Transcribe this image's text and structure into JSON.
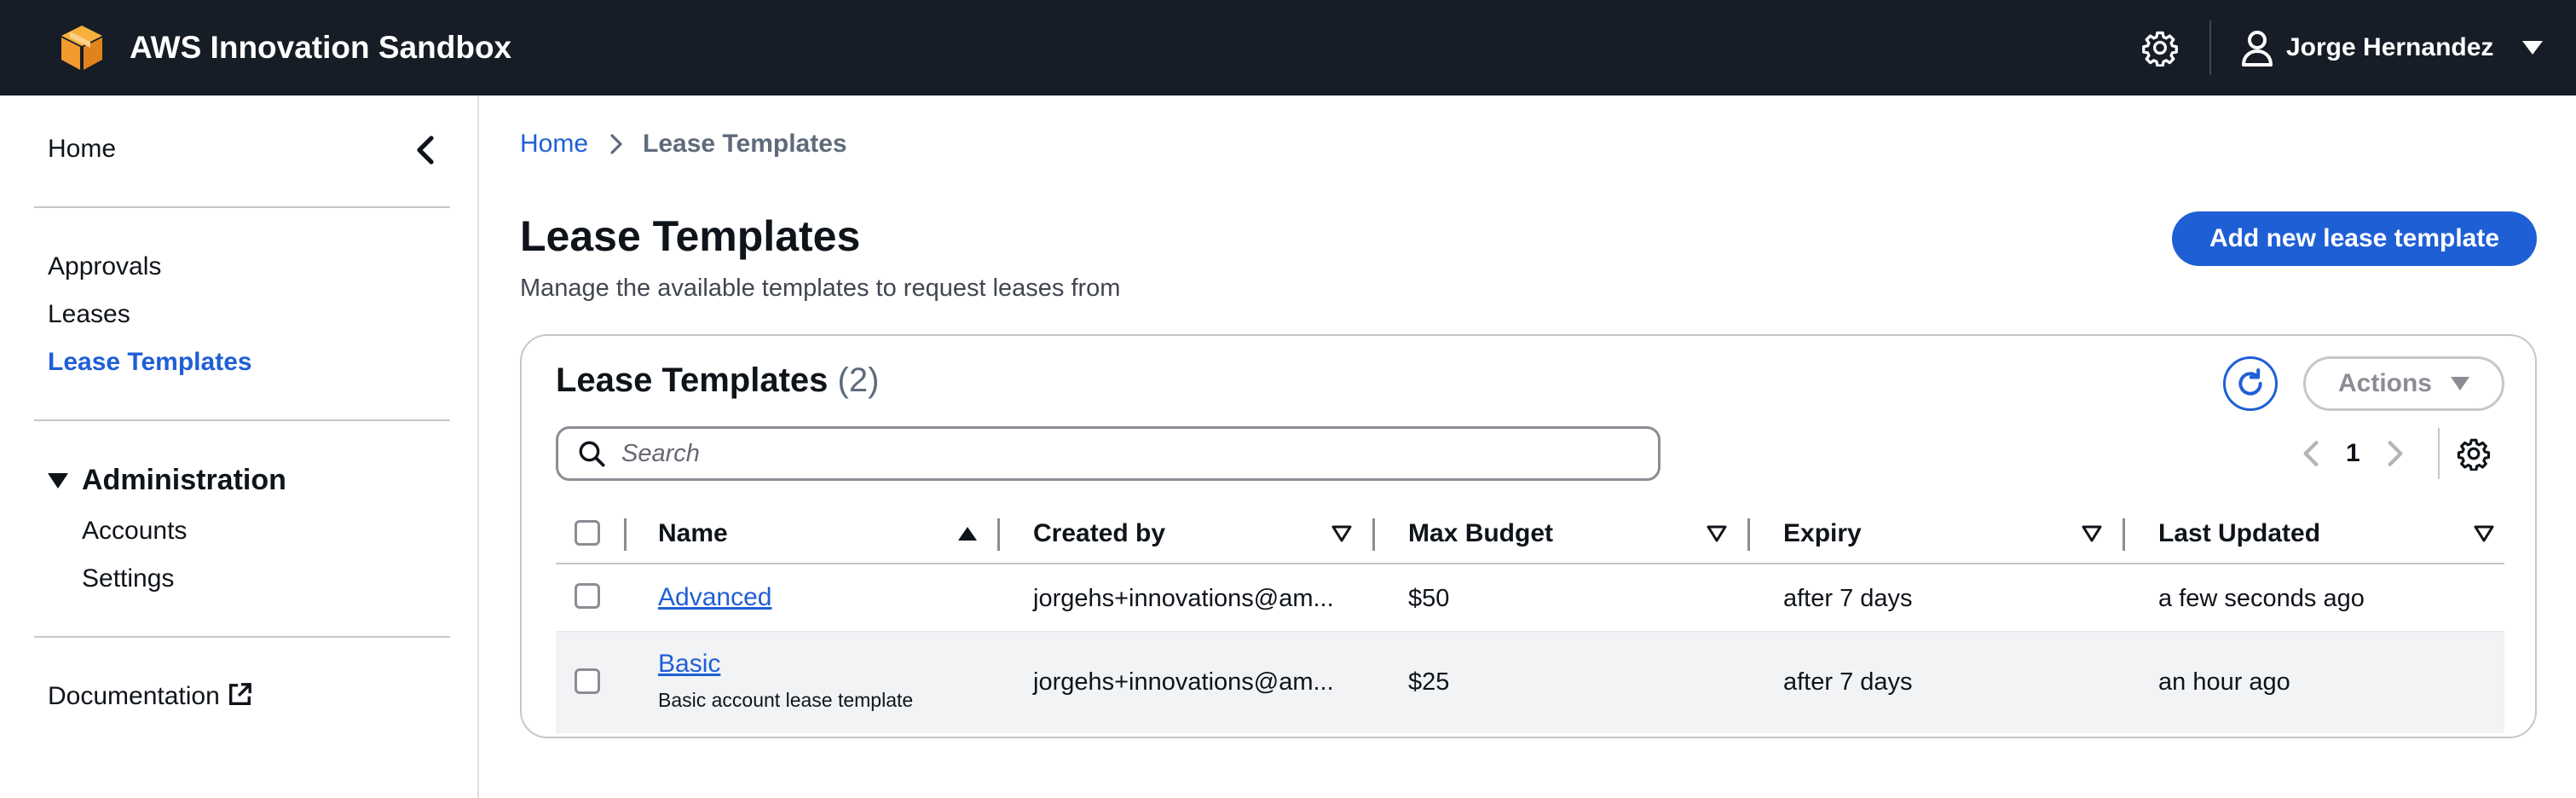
{
  "header": {
    "app_title": "AWS Innovation Sandbox",
    "user_name": "Jorge Hernandez",
    "colors": {
      "bar": "#161d26",
      "logo": "#f29a2e"
    }
  },
  "sidenav": {
    "home": "Home",
    "links": [
      "Approvals",
      "Leases",
      "Lease Templates"
    ],
    "active": "Lease Templates",
    "admin_section": {
      "title": "Administration",
      "items": [
        "Accounts",
        "Settings"
      ]
    },
    "documentation": "Documentation"
  },
  "breadcrumb": {
    "home": "Home",
    "current": "Lease Templates"
  },
  "page": {
    "title": "Lease Templates",
    "description": "Manage the available templates to request leases from",
    "add_button": "Add new lease template"
  },
  "card": {
    "title": "Lease Templates",
    "count": "(2)",
    "actions_label": "Actions",
    "search_placeholder": "Search",
    "current_page": "1"
  },
  "table": {
    "columns": [
      "Name",
      "Created by",
      "Max Budget",
      "Expiry",
      "Last Updated"
    ],
    "sorted_column": "Name",
    "sort_direction": "ascending",
    "rows": [
      {
        "name": "Advanced",
        "description": "",
        "created_by": "jorgehs+innovations@am...",
        "max_budget": "$50",
        "expiry": "after 7 days",
        "last_updated": "a few seconds ago"
      },
      {
        "name": "Basic",
        "description": "Basic account lease template",
        "created_by": "jorgehs+innovations@am...",
        "max_budget": "$25",
        "expiry": "after 7 days",
        "last_updated": "an hour ago"
      }
    ]
  },
  "accent_color": "#1f5fd6"
}
